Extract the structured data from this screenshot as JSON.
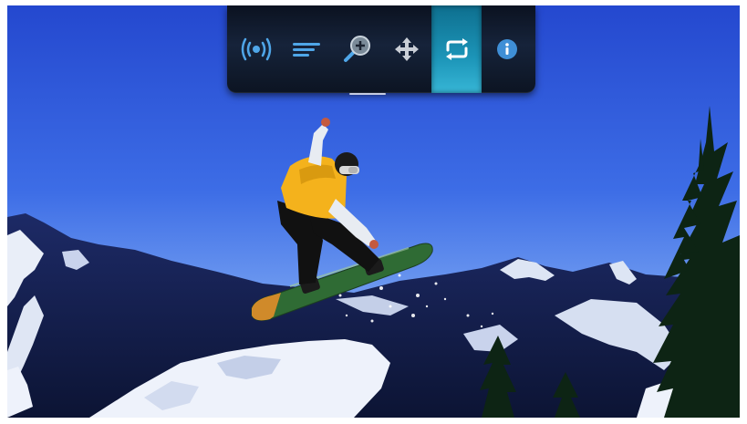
{
  "toolbar": {
    "buttons": [
      {
        "id": "stream",
        "icon": "wireless-stream-icon",
        "active": false
      },
      {
        "id": "menu",
        "icon": "menu-lines-icon",
        "active": false
      },
      {
        "id": "zoom",
        "icon": "zoom-in-icon",
        "active": false
      },
      {
        "id": "pan",
        "icon": "pan-move-icon",
        "active": false
      },
      {
        "id": "repeat",
        "icon": "repeat-icon",
        "active": true
      },
      {
        "id": "info",
        "icon": "info-icon",
        "active": false
      }
    ],
    "accent_color": "#1c95b8",
    "icon_color": "#4fa6e8"
  },
  "photo": {
    "subject": "snowboarder-jump",
    "sky_color": "#3a6ae4",
    "jacket_color": "#f4b21c",
    "board_color": "#3a7a3a"
  }
}
